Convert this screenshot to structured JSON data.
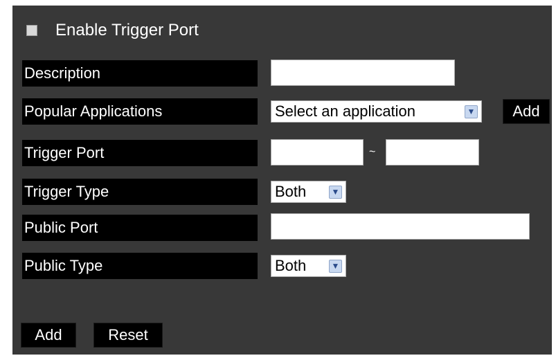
{
  "enable": {
    "label": "Enable Trigger Port",
    "checked": false
  },
  "fields": {
    "description": {
      "label": "Description",
      "value": ""
    },
    "popular_apps": {
      "label": "Popular Applications",
      "selected": "Select an application",
      "add_label": "Add"
    },
    "trigger_port": {
      "label": "Trigger Port",
      "from": "",
      "to": "",
      "separator": "~"
    },
    "trigger_type": {
      "label": "Trigger Type",
      "selected": "Both"
    },
    "public_port": {
      "label": "Public Port",
      "value": ""
    },
    "public_type": {
      "label": "Public Type",
      "selected": "Both"
    }
  },
  "actions": {
    "add_label": "Add",
    "reset_label": "Reset"
  },
  "icons": {
    "dropdown": "chevron-down-icon"
  }
}
